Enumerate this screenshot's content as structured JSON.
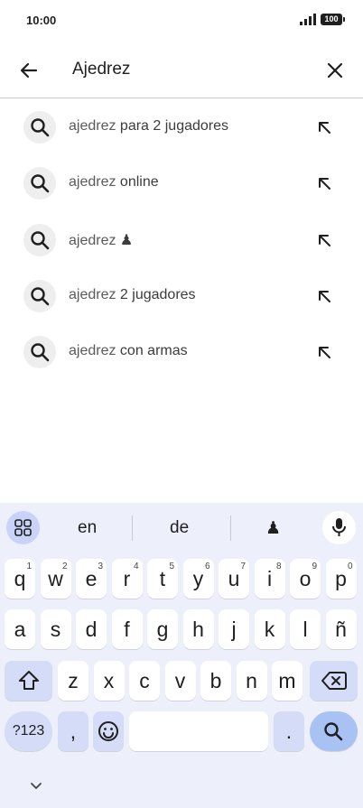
{
  "status": {
    "time": "10:00",
    "battery": "100"
  },
  "search": {
    "query": "Ajedrez"
  },
  "suggestions": [
    {
      "bold": "ajedrez",
      "rest": " para 2 jugadores"
    },
    {
      "bold": "ajedrez",
      "rest": " online"
    },
    {
      "bold": "ajedrez",
      "rest": " ♟"
    },
    {
      "bold": "ajedrez",
      "rest": " 2 jugadores"
    },
    {
      "bold": "ajedrez",
      "rest": " con armas"
    }
  ],
  "keyboard": {
    "suggestions": [
      "en",
      "de",
      "♟"
    ],
    "row1": [
      {
        "k": "q",
        "s": "1"
      },
      {
        "k": "w",
        "s": "2"
      },
      {
        "k": "e",
        "s": "3"
      },
      {
        "k": "r",
        "s": "4"
      },
      {
        "k": "t",
        "s": "5"
      },
      {
        "k": "y",
        "s": "6"
      },
      {
        "k": "u",
        "s": "7"
      },
      {
        "k": "i",
        "s": "8"
      },
      {
        "k": "o",
        "s": "9"
      },
      {
        "k": "p",
        "s": "0"
      }
    ],
    "row2": [
      "a",
      "s",
      "d",
      "f",
      "g",
      "h",
      "j",
      "k",
      "l",
      "ñ"
    ],
    "row3": [
      "z",
      "x",
      "c",
      "v",
      "b",
      "n",
      "m"
    ],
    "symbols_key": "?123",
    "comma": ",",
    "period": "."
  }
}
